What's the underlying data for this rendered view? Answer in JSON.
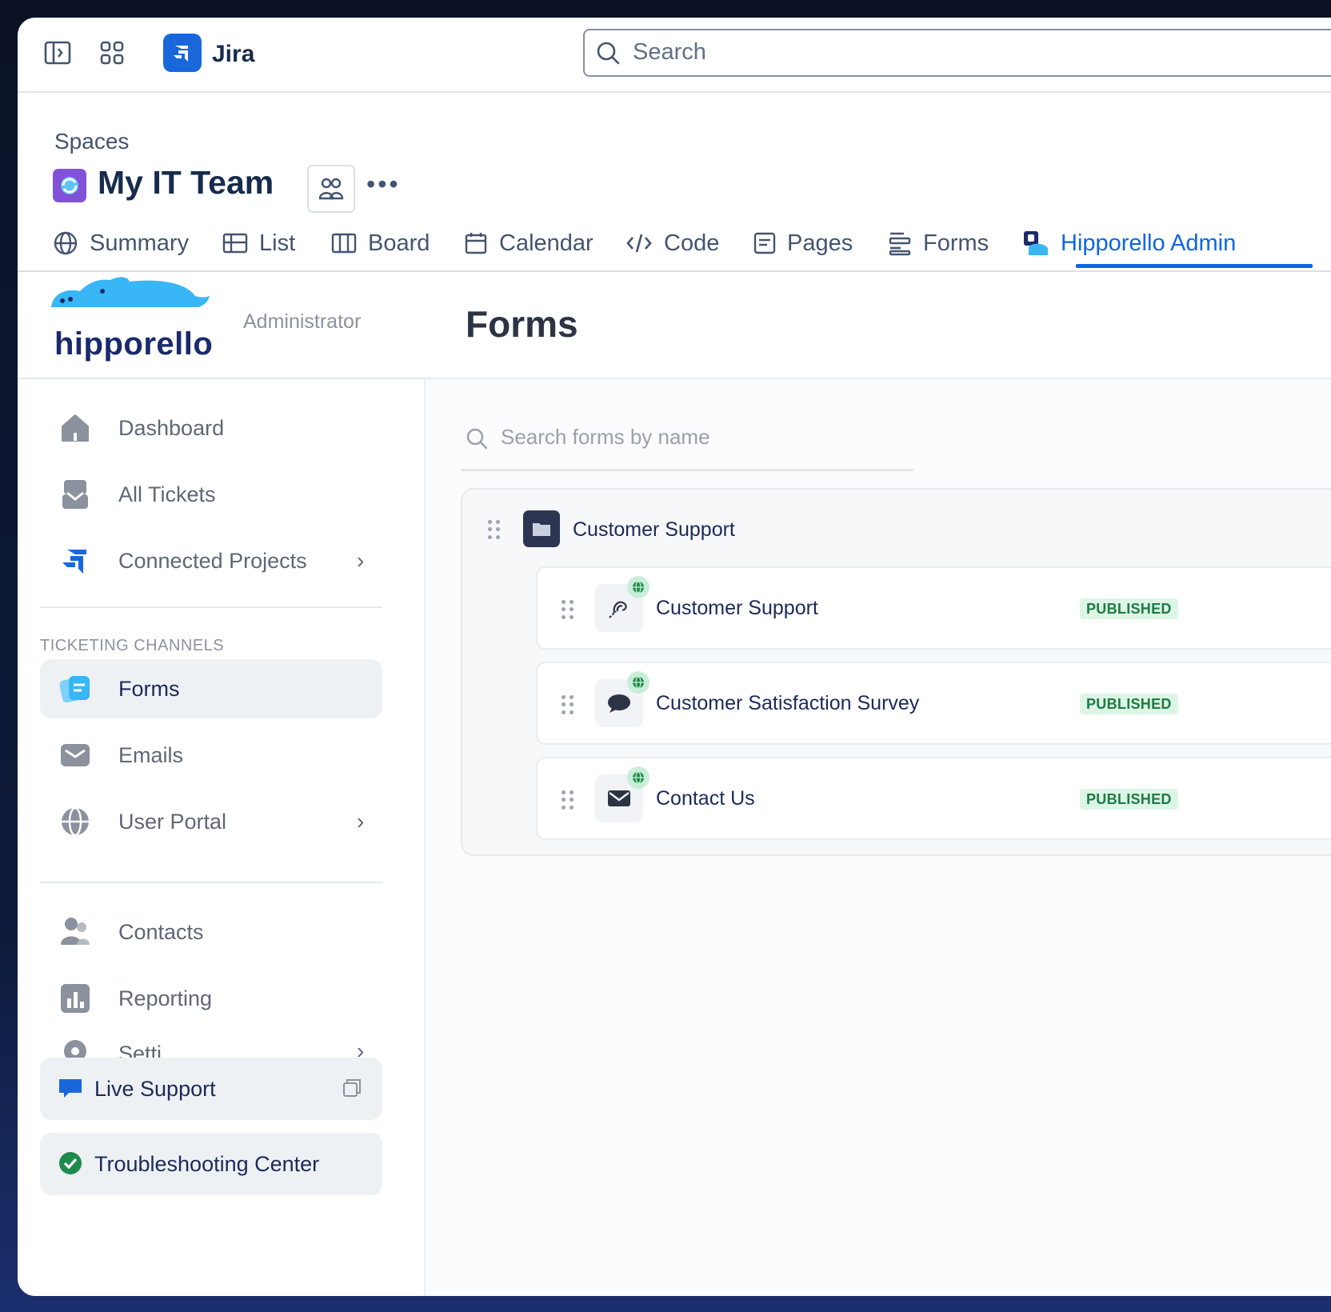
{
  "topbar": {
    "app_name": "Jira",
    "search_placeholder": "Search",
    "icons": [
      "sidebar-toggle-icon",
      "app-switcher-icon",
      "jira-logo-icon",
      "search-icon"
    ]
  },
  "space": {
    "breadcrumb": "Spaces",
    "title": "My IT Team",
    "more_label": "•••"
  },
  "tabs": [
    {
      "label": "Summary",
      "icon": "globe-icon"
    },
    {
      "label": "List",
      "icon": "list-icon"
    },
    {
      "label": "Board",
      "icon": "board-icon"
    },
    {
      "label": "Calendar",
      "icon": "calendar-icon"
    },
    {
      "label": "Code",
      "icon": "code-icon"
    },
    {
      "label": "Pages",
      "icon": "pages-icon"
    },
    {
      "label": "Forms",
      "icon": "forms-icon"
    },
    {
      "label": "Hipporello Admin",
      "icon": "hipporello-icon",
      "active": true
    }
  ],
  "app_header": {
    "logo_text": "hipporello",
    "role": "Administrator",
    "page_title": "Forms"
  },
  "sidebar": {
    "items_top": [
      {
        "label": "Dashboard",
        "icon": "home-icon"
      },
      {
        "label": "All Tickets",
        "icon": "inbox-icon"
      },
      {
        "label": "Connected Projects",
        "icon": "jira-icon",
        "chevron": "›"
      }
    ],
    "section_title": "TICKETING CHANNELS",
    "channels": [
      {
        "label": "Forms",
        "icon": "forms-icon",
        "active": true
      },
      {
        "label": "Emails",
        "icon": "mail-icon"
      },
      {
        "label": "User Portal",
        "icon": "globe-icon",
        "chevron": "›"
      }
    ],
    "items_bottom": [
      {
        "label": "Contacts",
        "icon": "contacts-icon"
      },
      {
        "label": "Reporting",
        "icon": "chart-icon"
      },
      {
        "label": "Setti",
        "icon": "settings-icon",
        "chevron": "›"
      }
    ],
    "live_support": "Live Support",
    "troubleshooting": "Troubleshooting Center"
  },
  "main": {
    "search_placeholder": "Search forms by name",
    "folder": {
      "name": "Customer Support",
      "forms": [
        {
          "name": "Customer Support",
          "status": "PUBLISHED",
          "icon": "accessibility-icon"
        },
        {
          "name": "Customer Satisfaction Survey",
          "status": "PUBLISHED",
          "icon": "chat-bubble-icon"
        },
        {
          "name": "Contact Us",
          "status": "PUBLISHED",
          "icon": "envelope-icon"
        }
      ]
    }
  },
  "colors": {
    "accent": "#0c66e4",
    "navy": "#1b2a5a",
    "published_bg": "#dcf5e4",
    "published_text": "#1f7a45",
    "hippo_blue": "#38b6f5"
  }
}
